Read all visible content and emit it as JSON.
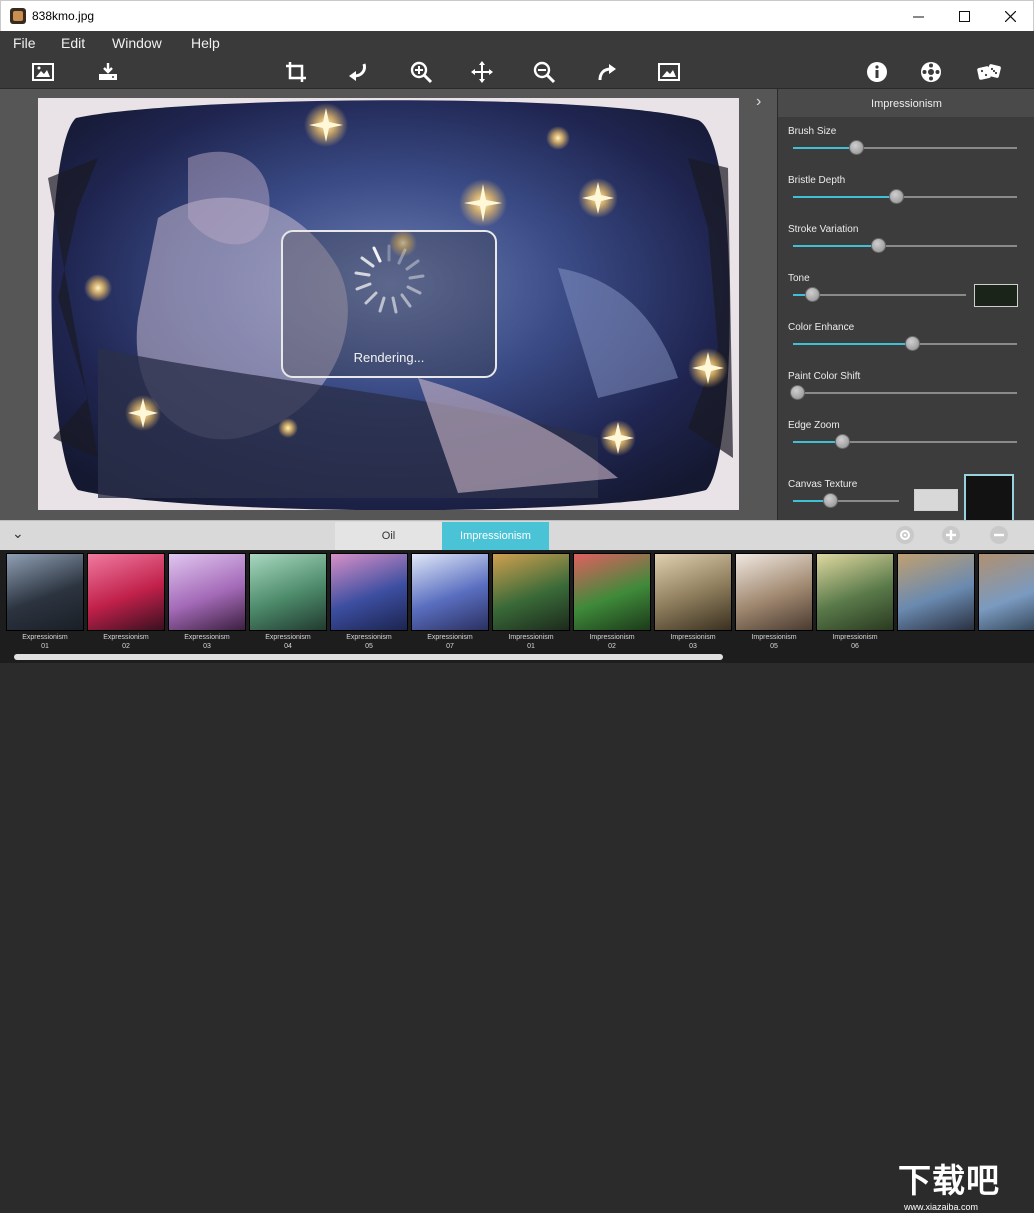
{
  "window": {
    "title": "838kmo.jpg",
    "controls": [
      "minimize",
      "maximize",
      "close"
    ]
  },
  "menu": [
    {
      "label": "File"
    },
    {
      "label": "Edit"
    },
    {
      "label": "Window"
    },
    {
      "label": "Help"
    }
  ],
  "toolbar": {
    "icons": [
      "open-image-icon",
      "save-icon",
      "crop-icon",
      "rotate-left-icon",
      "zoom-in-icon",
      "pan-icon",
      "zoom-out-icon",
      "rotate-right-icon",
      "fit-screen-icon",
      "info-icon",
      "settings-icon",
      "random-dice-icon"
    ]
  },
  "canvas": {
    "status_text": "Rendering...",
    "expand_symbol": "›"
  },
  "panel": {
    "title": "Impressionism",
    "sliders": [
      {
        "label": "Brush Size",
        "value": 0.28
      },
      {
        "label": "Bristle Depth",
        "value": 0.46
      },
      {
        "label": "Stroke Variation",
        "value": 0.38
      },
      {
        "label": "Tone",
        "value": 0.11
      },
      {
        "label": "Color Enhance",
        "value": 0.53
      },
      {
        "label": "Paint Color Shift",
        "value": 0.02
      },
      {
        "label": "Edge Zoom",
        "value": 0.22
      },
      {
        "label": "Canvas Texture",
        "value": 0.35
      }
    ],
    "tone_swatch_color": "#1b2418",
    "texture_swatch_color": "#d8d8d8",
    "texture_preview_color": "#121212",
    "accent_color": "#3fc0d4"
  },
  "bottom": {
    "collapse_symbol": "⌄",
    "tabs": [
      {
        "label": "Oil",
        "active": false
      },
      {
        "label": "Impressionism",
        "active": true
      }
    ],
    "buttons": [
      "preset-icon",
      "add-icon",
      "remove-icon"
    ]
  },
  "filmstrip": {
    "items": [
      {
        "name": "Expressionism",
        "num": "01"
      },
      {
        "name": "Expressionism",
        "num": "02"
      },
      {
        "name": "Expressionism",
        "num": "03"
      },
      {
        "name": "Expressionism",
        "num": "04"
      },
      {
        "name": "Expressionism",
        "num": "05"
      },
      {
        "name": "Expressionism",
        "num": "07"
      },
      {
        "name": "Impressionism",
        "num": "01"
      },
      {
        "name": "Impressionism",
        "num": "02"
      },
      {
        "name": "Impressionism",
        "num": "03"
      },
      {
        "name": "Impressionism",
        "num": "05"
      },
      {
        "name": "Impressionism",
        "num": "06"
      },
      {
        "name": "",
        "num": ""
      },
      {
        "name": "",
        "num": ""
      }
    ]
  },
  "watermark": {
    "text": "下载吧",
    "url": "www.xiazaiba.com"
  }
}
